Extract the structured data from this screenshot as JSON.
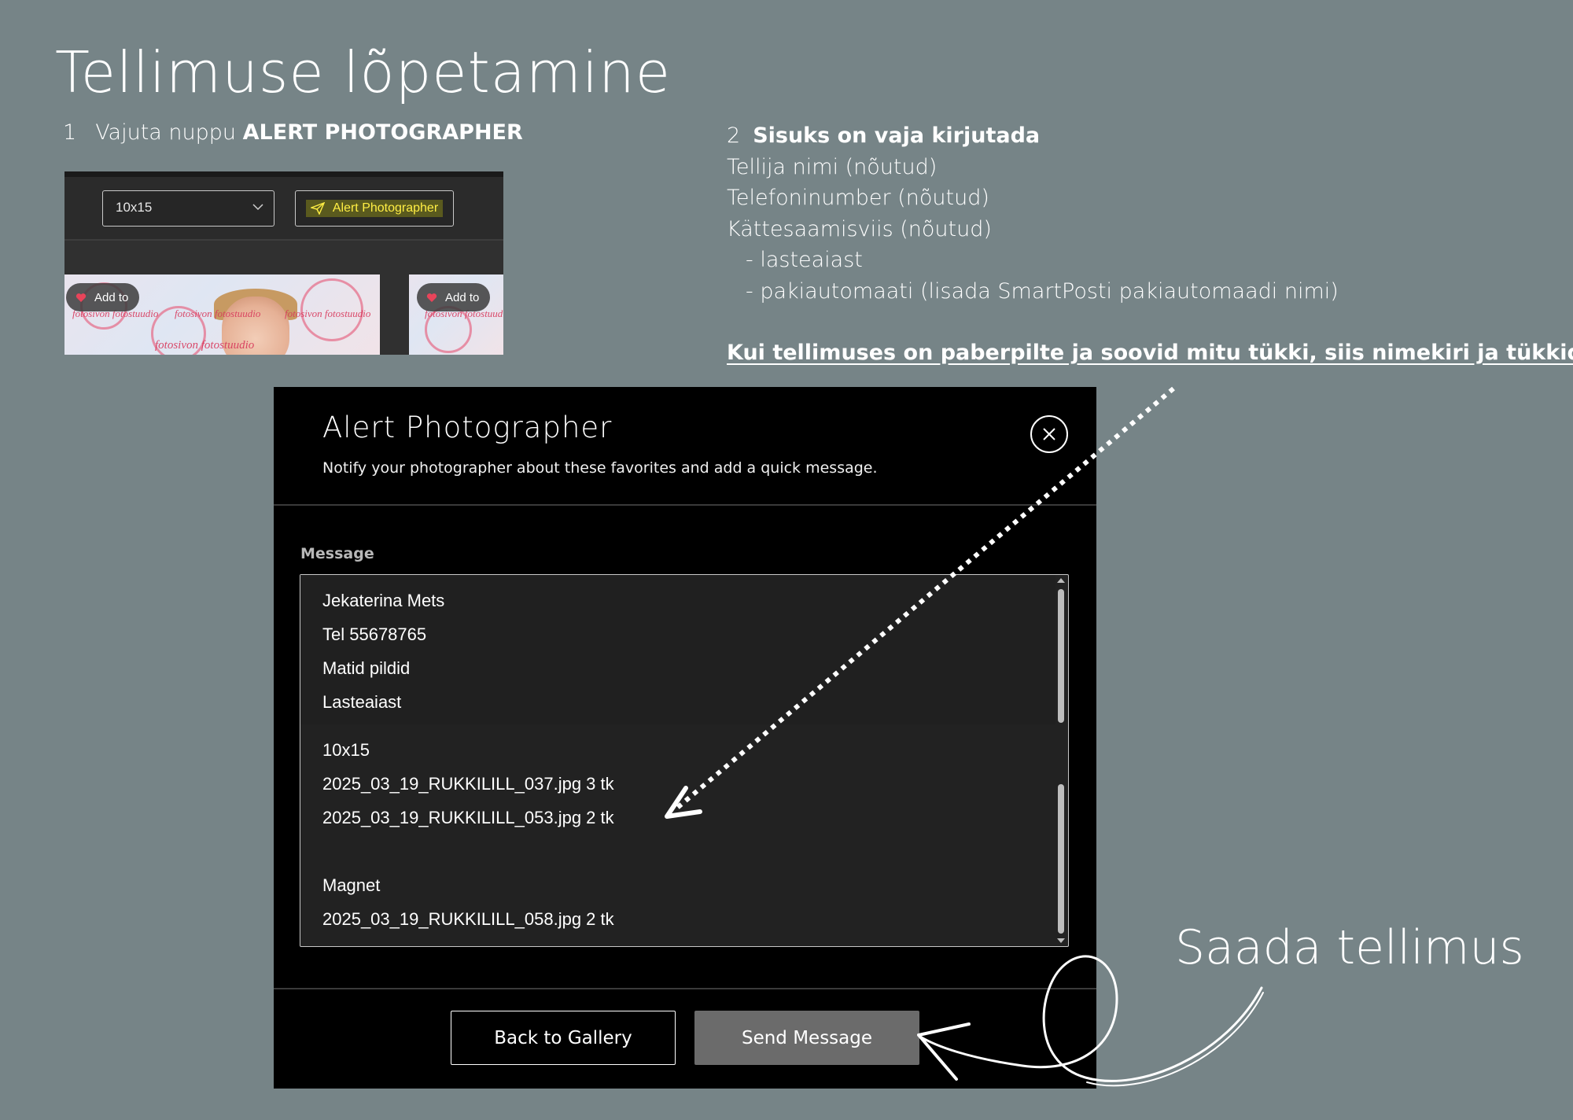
{
  "page_title": "Tellimuse lõpetamine",
  "step1": {
    "number": "1",
    "text": "Vajuta nuppu",
    "bold": "ALERT PHOTOGRAPHER"
  },
  "mini_screenshot": {
    "size_select_value": "10x15",
    "alert_button_label": "Alert Photographer",
    "add_to_label": "Add to",
    "watermark": "fotosivon fotostuudio",
    "highlight_color": "#ffee44"
  },
  "step2": {
    "number": "2",
    "heading": "Sisuks on vaja kirjutada",
    "lines": [
      "Tellija nimi (nõutud)",
      "Telefoninumber  (nõutud)",
      "Kättesaamisviis  (nõutud)"
    ],
    "sub_lines": [
      "- lasteaiast",
      "- pakiautomaati (lisada SmartPosti pakiautomaadi nimi)"
    ],
    "note": "Kui tellimuses on paberpilte ja soovid mitu tükki, siis nimekiri ja tükkide arv"
  },
  "dialog": {
    "title": "Alert Photographer",
    "subtitle": "Notify your photographer about these favorites and add a quick message.",
    "message_label": "Message",
    "message_lines": [
      "Jekaterina Mets",
      "Tel 55678765",
      "Matid pildid",
      "Lasteaiast",
      "10x15",
      "2025_03_19_RUKKILILL_037.jpg  3 tk",
      "2025_03_19_RUKKILILL_053.jpg   2 tk",
      "Magnet",
      "2025_03_19_RUKKILILL_058.jpg  2 tk"
    ],
    "back_label": "Back to Gallery",
    "send_label": "Send Message"
  },
  "annotation": {
    "send_hint": "Saada tellimus"
  },
  "colors": {
    "background": "#768487",
    "dialog_bg": "#000000",
    "send_button_bg": "#6b6b6b"
  }
}
